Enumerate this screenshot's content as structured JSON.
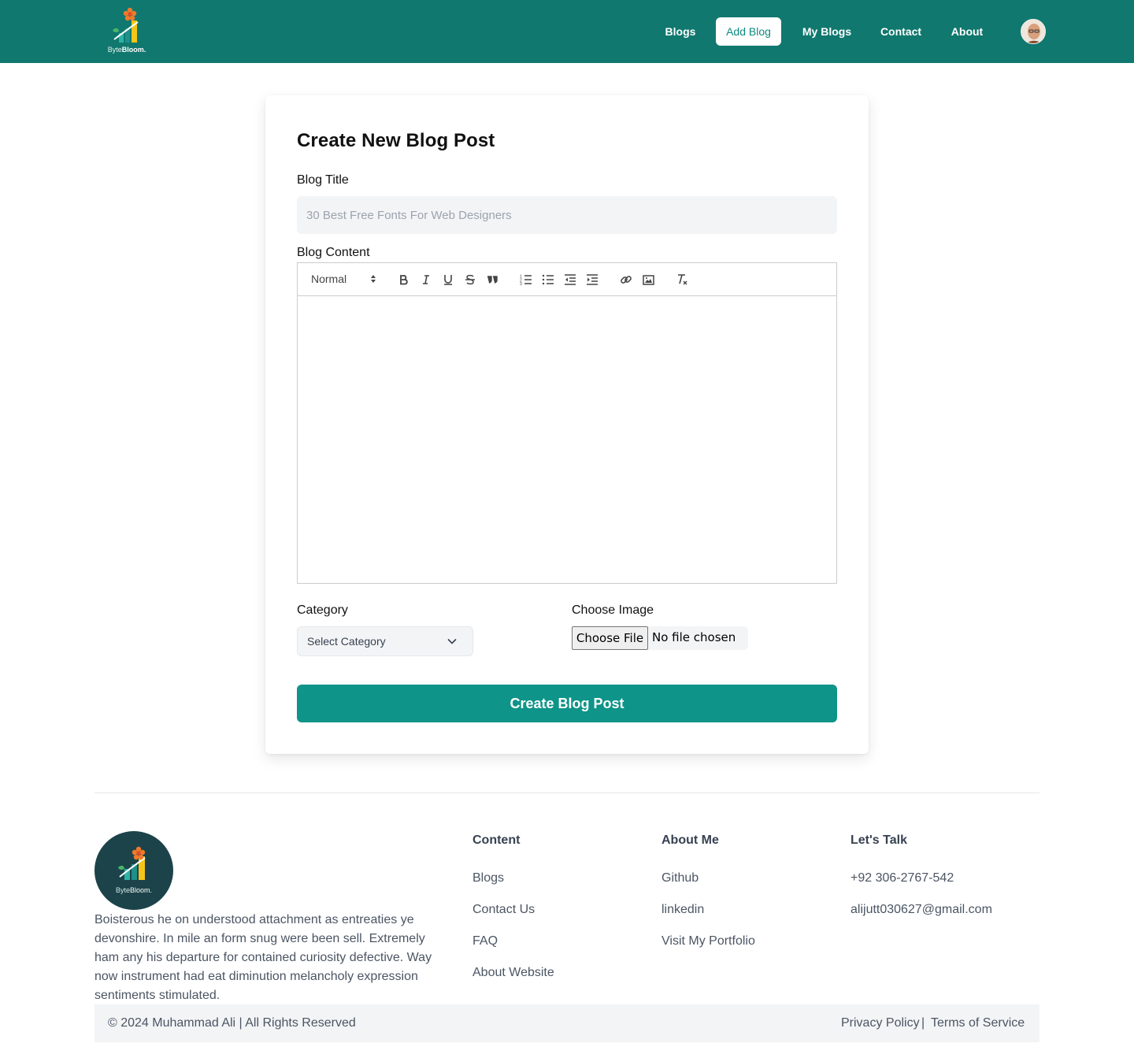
{
  "brand": {
    "logo_prefix": "Byte",
    "logo_suffix": "Bloom."
  },
  "nav": {
    "blogs": "Blogs",
    "add_blog": "Add Blog",
    "my_blogs": "My Blogs",
    "contact": "Contact",
    "about": "About"
  },
  "form": {
    "heading": "Create New Blog Post",
    "title_label": "Blog Title",
    "title_placeholder": "30 Best Free Fonts For Web Designers",
    "content_label": "Blog Content",
    "editor_style": "Normal",
    "category_label": "Category",
    "category_value": "Select Category",
    "image_label": "Choose Image",
    "file_button": "Choose File",
    "file_status": "No file chosen",
    "submit": "Create Blog Post"
  },
  "toolbar_icons": [
    "bold-icon",
    "italic-icon",
    "underline-icon",
    "strike-icon",
    "blockquote-icon",
    "ordered-list-icon",
    "bullet-list-icon",
    "outdent-icon",
    "indent-icon",
    "link-icon",
    "image-icon",
    "clean-format-icon"
  ],
  "footer": {
    "logo_prefix": "Byte",
    "logo_suffix": "Bloom.",
    "description": "Boisterous he on understood attachment as entreaties ye devonshire. In mile an form snug were been sell. Extremely ham any his departure for contained curiosity defective. Way now instrument had eat diminution melancholy expression sentiments stimulated.",
    "content": {
      "heading": "Content",
      "links": [
        "Blogs",
        "Contact Us",
        "FAQ",
        "About Website"
      ]
    },
    "about_me": {
      "heading": "About Me",
      "links": [
        "Github",
        "linkedin",
        "Visit My Portfolio"
      ]
    },
    "lets_talk": {
      "heading": "Let's Talk",
      "phone": "+92 306-2767-542",
      "email": "alijutt030627@gmail.com"
    },
    "copyright": "© 2024 Muhammad Ali | All Rights Reserved",
    "privacy": "Privacy Policy",
    "separator": "|",
    "terms": "Terms of Service"
  },
  "colors": {
    "header": "#10786e",
    "accent": "#0e9488",
    "active_nav_text": "#0d8a80"
  }
}
